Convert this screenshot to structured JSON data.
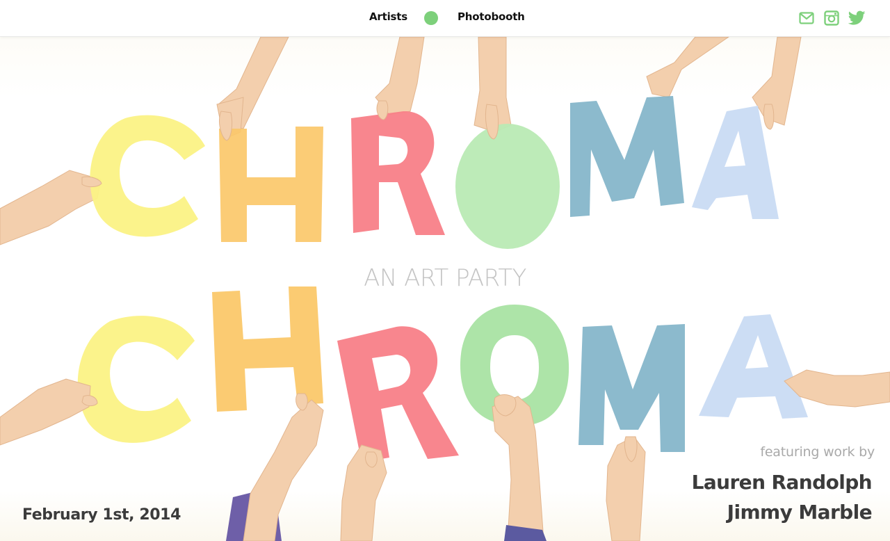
{
  "nav": {
    "artists_label": "Artists",
    "photobooth_label": "Photobooth",
    "dot_color": "#7dd07b"
  },
  "social": {
    "icons": [
      "mail-icon",
      "instagram-icon",
      "twitter-icon"
    ],
    "color": "#7dd07b"
  },
  "hero": {
    "tagline": "AN ART PARTY",
    "featuring_label": "featuring work by",
    "artists": [
      "Lauren Randolph",
      "Jimmy Marble"
    ],
    "date": "February 1st, 2014",
    "letters": [
      "C",
      "H",
      "R",
      "O",
      "M",
      "A"
    ],
    "letter_colors": [
      "#fbf285",
      "#fbc86a",
      "#f87f88",
      "#b9eab4",
      "#7fb3c8",
      "#c9dbf3"
    ]
  }
}
